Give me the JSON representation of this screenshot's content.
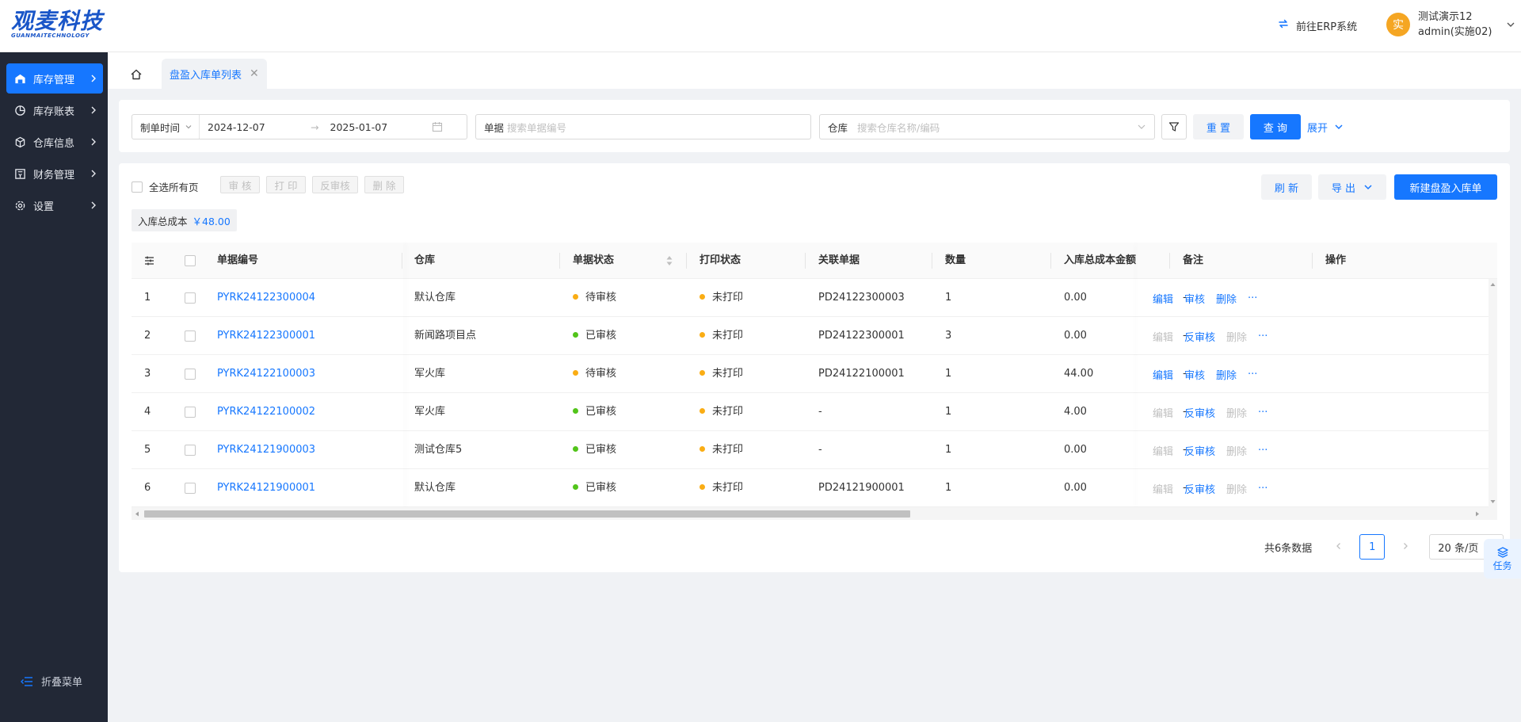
{
  "header": {
    "logo_main": "观麦科技",
    "logo_sub": "GUANMAITECHNOLOGY",
    "erp_link": "前往ERP系统",
    "avatar_char": "实",
    "user_name": "测试演示12",
    "user_account": "admin(实施02)"
  },
  "sidebar": {
    "items": [
      {
        "label": "库存管理",
        "icon": "warehouse-icon"
      },
      {
        "label": "库存账表",
        "icon": "pie-chart-icon"
      },
      {
        "label": "仓库信息",
        "icon": "cube-icon"
      },
      {
        "label": "财务管理",
        "icon": "finance-icon"
      },
      {
        "label": "设置",
        "icon": "gear-icon"
      }
    ],
    "active_index": 0,
    "collapse_label": "折叠菜单"
  },
  "tabs": {
    "active_label": "盘盈入库单列表"
  },
  "filter": {
    "date_type": "制单时间",
    "date_start": "2024-12-07",
    "date_end": "2025-01-07",
    "doc_label": "单据",
    "doc_placeholder": "搜索单据编号",
    "warehouse_label": "仓库",
    "warehouse_placeholder": "搜索仓库名称/编码",
    "reset_label": "重 置",
    "query_label": "查 询",
    "expand_label": "展开"
  },
  "toolbar": {
    "select_all_label": "全选所有页",
    "audit_label": "审 核",
    "print_label": "打 印",
    "unaudit_label": "反审核",
    "delete_label": "删 除",
    "refresh_label": "刷 新",
    "export_label": "导 出",
    "create_label": "新建盘盈入库单"
  },
  "summary": {
    "label": "入库总成本",
    "amount": "￥48.00"
  },
  "table": {
    "columns": [
      "单据编号",
      "仓库",
      "单据状态",
      "打印状态",
      "关联单据",
      "数量",
      "入库总成本金额",
      "备注",
      "操作"
    ],
    "rows": [
      {
        "index": "1",
        "code": "PYRK24122300004",
        "warehouse": "默认仓库",
        "status": "待审核",
        "status_color": "#faad14",
        "print": "未打印",
        "related": "PD24122300003",
        "qty": "1",
        "cost": "0.00",
        "note": "-",
        "ops": [
          "编辑",
          "审核",
          "删除",
          "···"
        ],
        "ops_enabled": [
          true,
          true,
          true,
          true
        ]
      },
      {
        "index": "2",
        "code": "PYRK24122300001",
        "warehouse": "新闻路项目点",
        "status": "已审核",
        "status_color": "#52c41a",
        "print": "未打印",
        "related": "PD24122300001",
        "qty": "3",
        "cost": "0.00",
        "note": "-",
        "ops": [
          "编辑",
          "反审核",
          "删除",
          "···"
        ],
        "ops_enabled": [
          false,
          true,
          false,
          true
        ]
      },
      {
        "index": "3",
        "code": "PYRK24122100003",
        "warehouse": "军火库",
        "status": "待审核",
        "status_color": "#faad14",
        "print": "未打印",
        "related": "PD24122100001",
        "qty": "1",
        "cost": "44.00",
        "note": "-",
        "ops": [
          "编辑",
          "审核",
          "删除",
          "···"
        ],
        "ops_enabled": [
          true,
          true,
          true,
          true
        ]
      },
      {
        "index": "4",
        "code": "PYRK24122100002",
        "warehouse": "军火库",
        "status": "已审核",
        "status_color": "#52c41a",
        "print": "未打印",
        "related": "-",
        "qty": "1",
        "cost": "4.00",
        "note": "-",
        "ops": [
          "编辑",
          "反审核",
          "删除",
          "···"
        ],
        "ops_enabled": [
          false,
          true,
          false,
          true
        ]
      },
      {
        "index": "5",
        "code": "PYRK24121900003",
        "warehouse": "测试仓库5",
        "status": "已审核",
        "status_color": "#52c41a",
        "print": "未打印",
        "related": "-",
        "qty": "1",
        "cost": "0.00",
        "note": "-",
        "ops": [
          "编辑",
          "反审核",
          "删除",
          "···"
        ],
        "ops_enabled": [
          false,
          true,
          false,
          true
        ]
      },
      {
        "index": "6",
        "code": "PYRK24121900001",
        "warehouse": "默认仓库",
        "status": "已审核",
        "status_color": "#52c41a",
        "print": "未打印",
        "related": "PD24121900001",
        "qty": "1",
        "cost": "0.00",
        "note": "-",
        "ops": [
          "编辑",
          "反审核",
          "删除",
          "···"
        ],
        "ops_enabled": [
          false,
          true,
          false,
          true
        ]
      }
    ],
    "print_color": "#faad14"
  },
  "pagination": {
    "total_text": "共6条数据",
    "current_page": "1",
    "page_size": "20 条/页"
  },
  "task_float": {
    "label": "任务"
  },
  "colors": {
    "primary": "#1677ff",
    "sidebar_bg": "#222836",
    "pending": "#faad14",
    "approved": "#52c41a"
  }
}
